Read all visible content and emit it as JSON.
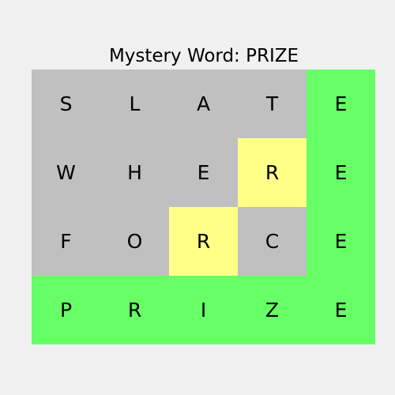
{
  "title": "Mystery Word: PRIZE",
  "colors": {
    "absent": "#c0c0c0",
    "present": "#ffff88",
    "correct": "#66ff66",
    "background": "#f0f0f0"
  },
  "board": {
    "rows": [
      [
        {
          "letter": "S",
          "state": "absent"
        },
        {
          "letter": "L",
          "state": "absent"
        },
        {
          "letter": "A",
          "state": "absent"
        },
        {
          "letter": "T",
          "state": "absent"
        },
        {
          "letter": "E",
          "state": "correct"
        }
      ],
      [
        {
          "letter": "W",
          "state": "absent"
        },
        {
          "letter": "H",
          "state": "absent"
        },
        {
          "letter": "E",
          "state": "absent"
        },
        {
          "letter": "R",
          "state": "present"
        },
        {
          "letter": "E",
          "state": "correct"
        }
      ],
      [
        {
          "letter": "F",
          "state": "absent"
        },
        {
          "letter": "O",
          "state": "absent"
        },
        {
          "letter": "R",
          "state": "present"
        },
        {
          "letter": "C",
          "state": "absent"
        },
        {
          "letter": "E",
          "state": "correct"
        }
      ],
      [
        {
          "letter": "P",
          "state": "correct"
        },
        {
          "letter": "R",
          "state": "correct"
        },
        {
          "letter": "I",
          "state": "correct"
        },
        {
          "letter": "Z",
          "state": "correct"
        },
        {
          "letter": "E",
          "state": "correct"
        }
      ]
    ]
  }
}
